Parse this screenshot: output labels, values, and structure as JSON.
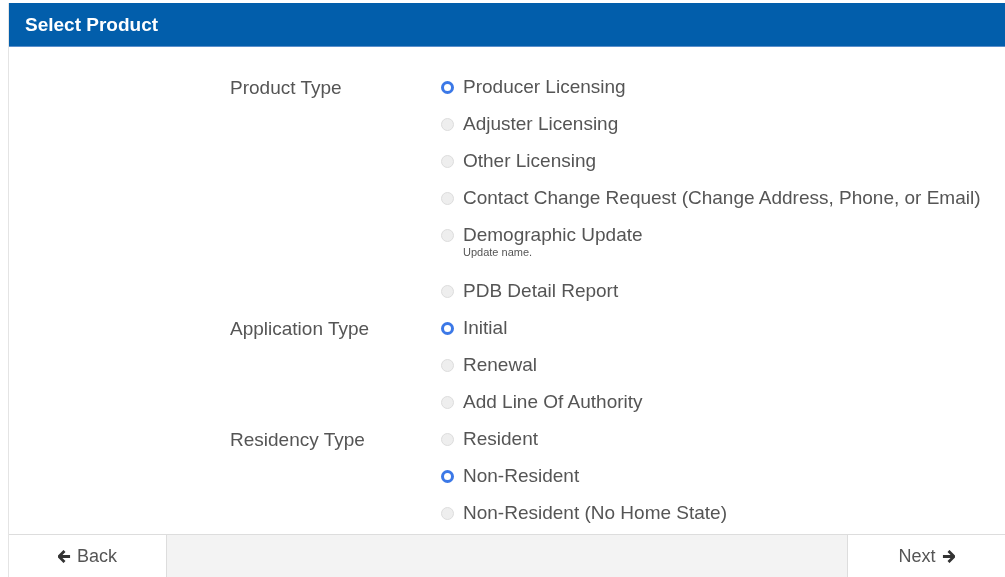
{
  "header": {
    "title": "Select Product"
  },
  "sections": [
    {
      "label": "Product Type",
      "options": [
        {
          "label": "Producer Licensing",
          "selected": true
        },
        {
          "label": "Adjuster Licensing",
          "selected": false
        },
        {
          "label": "Other Licensing",
          "selected": false
        },
        {
          "label": "Contact Change Request (Change Address, Phone, or Email)",
          "selected": false
        },
        {
          "label": "Demographic Update",
          "hint": "Update name.",
          "selected": false
        },
        {
          "label": "PDB Detail Report",
          "selected": false
        }
      ]
    },
    {
      "label": "Application Type",
      "options": [
        {
          "label": "Initial",
          "selected": true
        },
        {
          "label": "Renewal",
          "selected": false
        },
        {
          "label": "Add Line Of Authority",
          "selected": false
        }
      ]
    },
    {
      "label": "Residency Type",
      "options": [
        {
          "label": "Resident",
          "selected": false
        },
        {
          "label": "Non-Resident",
          "selected": true
        },
        {
          "label": "Non-Resident (No Home State)",
          "selected": false
        }
      ]
    }
  ],
  "footer": {
    "back": "Back",
    "next": "Next"
  }
}
